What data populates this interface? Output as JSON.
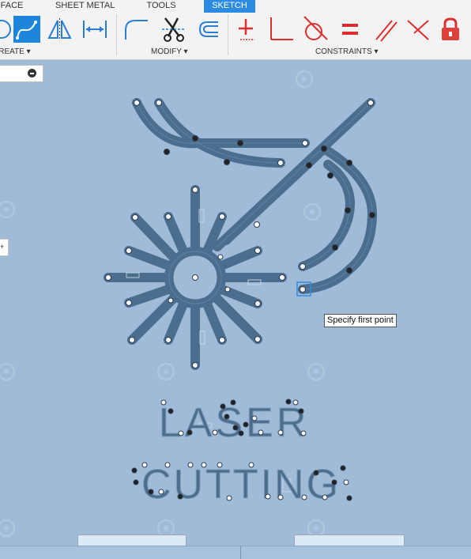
{
  "tabs": [
    {
      "label": "FACE",
      "active": false
    },
    {
      "label": "SHEET METAL",
      "active": false
    },
    {
      "label": "TOOLS",
      "active": false
    },
    {
      "label": "SKETCH",
      "active": true
    }
  ],
  "groups": {
    "create": "CREATE",
    "modify": "MODIFY",
    "constraints": "CONSTRAINTS"
  },
  "tools": [
    {
      "name": "spline-icon",
      "group": "create",
      "active": true
    },
    {
      "name": "mirror-icon",
      "group": "create"
    },
    {
      "name": "dimension-icon",
      "group": "create"
    },
    {
      "name": "fillet-icon",
      "group": "modify"
    },
    {
      "name": "trim-scissors-icon",
      "group": "modify"
    },
    {
      "name": "offset-icon",
      "group": "modify"
    },
    {
      "name": "coincident-icon",
      "group": "constraints"
    },
    {
      "name": "perpendicular-icon",
      "group": "constraints"
    },
    {
      "name": "tangent-icon",
      "group": "constraints"
    },
    {
      "name": "equal-icon",
      "group": "constraints"
    },
    {
      "name": "parallel-icon",
      "group": "constraints"
    },
    {
      "name": "collinear-icon",
      "group": "constraints"
    },
    {
      "name": "lock-icon",
      "group": "constraints"
    }
  ],
  "tooltip": "Specify first point",
  "side_tab": "+",
  "logo_text": {
    "line1": "LASER",
    "line2": "CUTTING"
  },
  "colors": {
    "active_tab": "#2c8be0",
    "canvas_bg": "#9fbbd8",
    "sketch_stroke": "#4b6d8e",
    "constraint_red": "#d9302f"
  }
}
